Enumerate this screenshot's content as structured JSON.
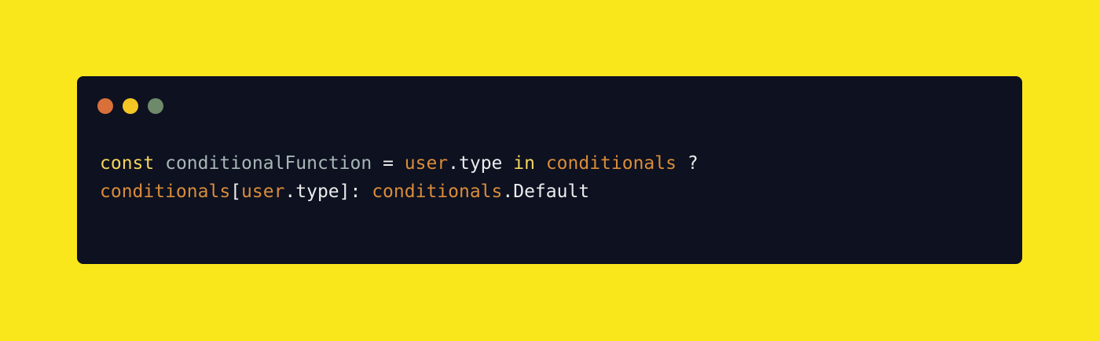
{
  "theme": {
    "background": "#f9e71c",
    "window_background": "#0d1120",
    "keyword_color": "#f4d35e",
    "identifier_color": "#a8b6b6",
    "variable_color": "#d98c3a",
    "plain_color": "#ececec"
  },
  "window_controls": [
    {
      "name": "close-button",
      "color": "#d9703a"
    },
    {
      "name": "minimize-button",
      "color": "#f3c623"
    },
    {
      "name": "maximize-button",
      "color": "#6f8a6a"
    }
  ],
  "code": {
    "line1": {
      "t1": "const",
      "t2": " ",
      "t3": "conditionalFunction",
      "t4": " = ",
      "t5": "user",
      "t6": ".type ",
      "t7": "in",
      "t8": " ",
      "t9": "conditionals",
      "t10": " ?"
    },
    "line2": {
      "t1": "conditionals",
      "t2": "[",
      "t3": "user",
      "t4": ".type]: ",
      "t5": "conditionals",
      "t6": ".Default"
    }
  }
}
